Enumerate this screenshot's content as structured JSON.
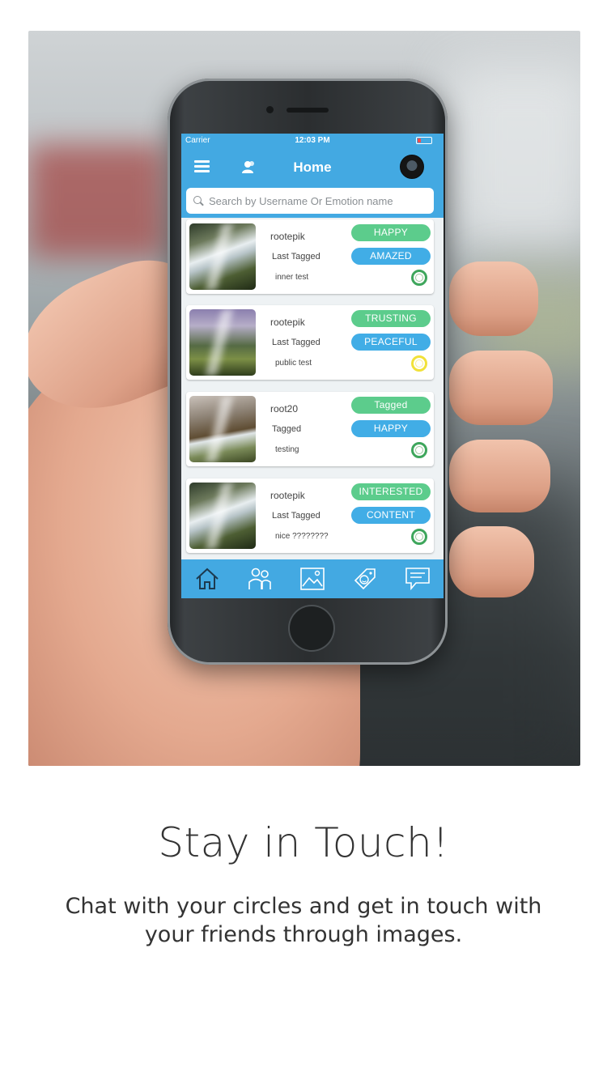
{
  "status_bar": {
    "carrier": "Carrier",
    "time": "12:03 PM"
  },
  "nav": {
    "title": "Home",
    "menu_icon": "menu-icon",
    "people_icon": "people-icon"
  },
  "search": {
    "placeholder": "Search by Username Or Emotion name"
  },
  "cards": [
    {
      "user": "rootepik",
      "subtitle": "Last Tagged",
      "note": "inner test",
      "top_tag": "HAPPY",
      "bottom_tag": "AMAZED",
      "ring_color": "#3ea65c"
    },
    {
      "user": "rootepik",
      "subtitle": "Last Tagged",
      "note": "public test",
      "top_tag": "TRUSTING",
      "bottom_tag": "PEACEFUL",
      "ring_color": "#f1e13a"
    },
    {
      "user": "root20",
      "subtitle": "Tagged",
      "note": "testing",
      "top_tag": "Tagged",
      "bottom_tag": "HAPPY",
      "ring_color": "#3ea65c"
    },
    {
      "user": "rootepik",
      "subtitle": "Last Tagged",
      "note": "nice ????????",
      "top_tag": "INTERESTED",
      "bottom_tag": "CONTENT",
      "ring_color": "#3ea65c"
    }
  ],
  "tabs": [
    "home-icon",
    "friends-icon",
    "gallery-icon",
    "tag-icon",
    "chat-icon"
  ],
  "colors": {
    "accent": "#43a9e2",
    "green_tag": "#5ccc8c",
    "blue_tag": "#41ade6"
  },
  "headline": "Stay in Touch!",
  "body_text": "Chat with your circles and get in touch with your friends through images."
}
